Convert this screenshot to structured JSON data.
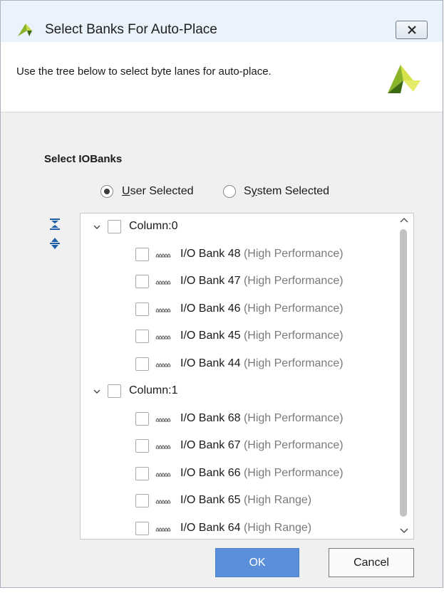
{
  "window": {
    "title": "Select Banks For Auto-Place",
    "close_glyph": "✕"
  },
  "header": {
    "description": "Use the tree below to select byte lanes for auto-place."
  },
  "section": {
    "title": "Select IOBanks"
  },
  "selection_mode": {
    "options": [
      {
        "label_prefix": "",
        "mnemonic": "U",
        "label_rest": "ser Selected",
        "checked": true
      },
      {
        "label_prefix": "S",
        "mnemonic": "y",
        "label_rest": "stem Selected",
        "checked": false
      }
    ]
  },
  "tree": {
    "columns": [
      {
        "label": "Column:0",
        "expanded": true,
        "banks": [
          {
            "name": "I/O Bank 48",
            "type": "(High Performance)"
          },
          {
            "name": "I/O Bank 47",
            "type": "(High Performance)"
          },
          {
            "name": "I/O Bank 46",
            "type": "(High Performance)"
          },
          {
            "name": "I/O Bank 45",
            "type": "(High Performance)"
          },
          {
            "name": "I/O Bank 44",
            "type": "(High Performance)"
          }
        ]
      },
      {
        "label": "Column:1",
        "expanded": true,
        "banks": [
          {
            "name": "I/O Bank 68",
            "type": "(High Performance)"
          },
          {
            "name": "I/O Bank 67",
            "type": "(High Performance)"
          },
          {
            "name": "I/O Bank 66",
            "type": "(High Performance)"
          },
          {
            "name": "I/O Bank 65",
            "type": "(High Range)"
          },
          {
            "name": "I/O Bank 64",
            "type": "(High Range)"
          }
        ]
      }
    ]
  },
  "buttons": {
    "ok": "OK",
    "cancel": "Cancel"
  },
  "colors": {
    "accent": "#5b8fd9",
    "logo_green": "#8ab52a",
    "logo_dark": "#3d6b14",
    "icon_blue": "#1f5fa8"
  }
}
